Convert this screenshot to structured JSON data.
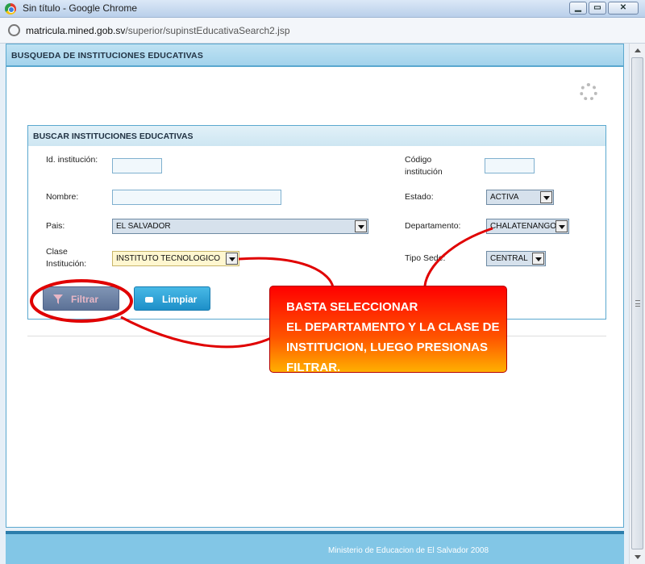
{
  "window": {
    "title": "Sin título - Google Chrome",
    "minimize": "▁",
    "maximize": "▭",
    "close": "✕"
  },
  "address": {
    "domain": "matricula.mined.gob.sv",
    "path": "/superior/supinstEducativaSearch2.jsp"
  },
  "panel": {
    "title": "BUSQUEDA DE INSTITUCIONES EDUCATIVAS"
  },
  "search": {
    "title": "BUSCAR INSTITUCIONES EDUCATIVAS",
    "fields": {
      "id_label": "Id. institución:",
      "codigo_label": "Código institución",
      "nombre_label": "Nombre:",
      "estado_label": "Estado:",
      "estado_value": "ACTIVA",
      "pais_label": "Pais:",
      "pais_value": "EL SALVADOR",
      "departamento_label": "Departamento:",
      "departamento_value": "CHALATENANGO",
      "clase_label": "Clase Institución:",
      "clase_value": "INSTITUTO TECNOLOGICO",
      "tipo_sede_label": "Tipo Sede:",
      "tipo_sede_value": "CENTRAL"
    },
    "buttons": {
      "filtrar": "Filtrar",
      "limpiar": "Limpiar"
    }
  },
  "footer": {
    "text": "Ministerio de Educacion de El Salvador 2008"
  },
  "annotation": {
    "text": "BASTA SELECCIONAR\nEL DEPARTAMENTO Y LA CLASE DE\nINSTITUCION, LUEGO PRESIONAS\nFILTRAR."
  },
  "colors": {
    "accent": "#5aa8cf",
    "callout": "#ff3300"
  }
}
